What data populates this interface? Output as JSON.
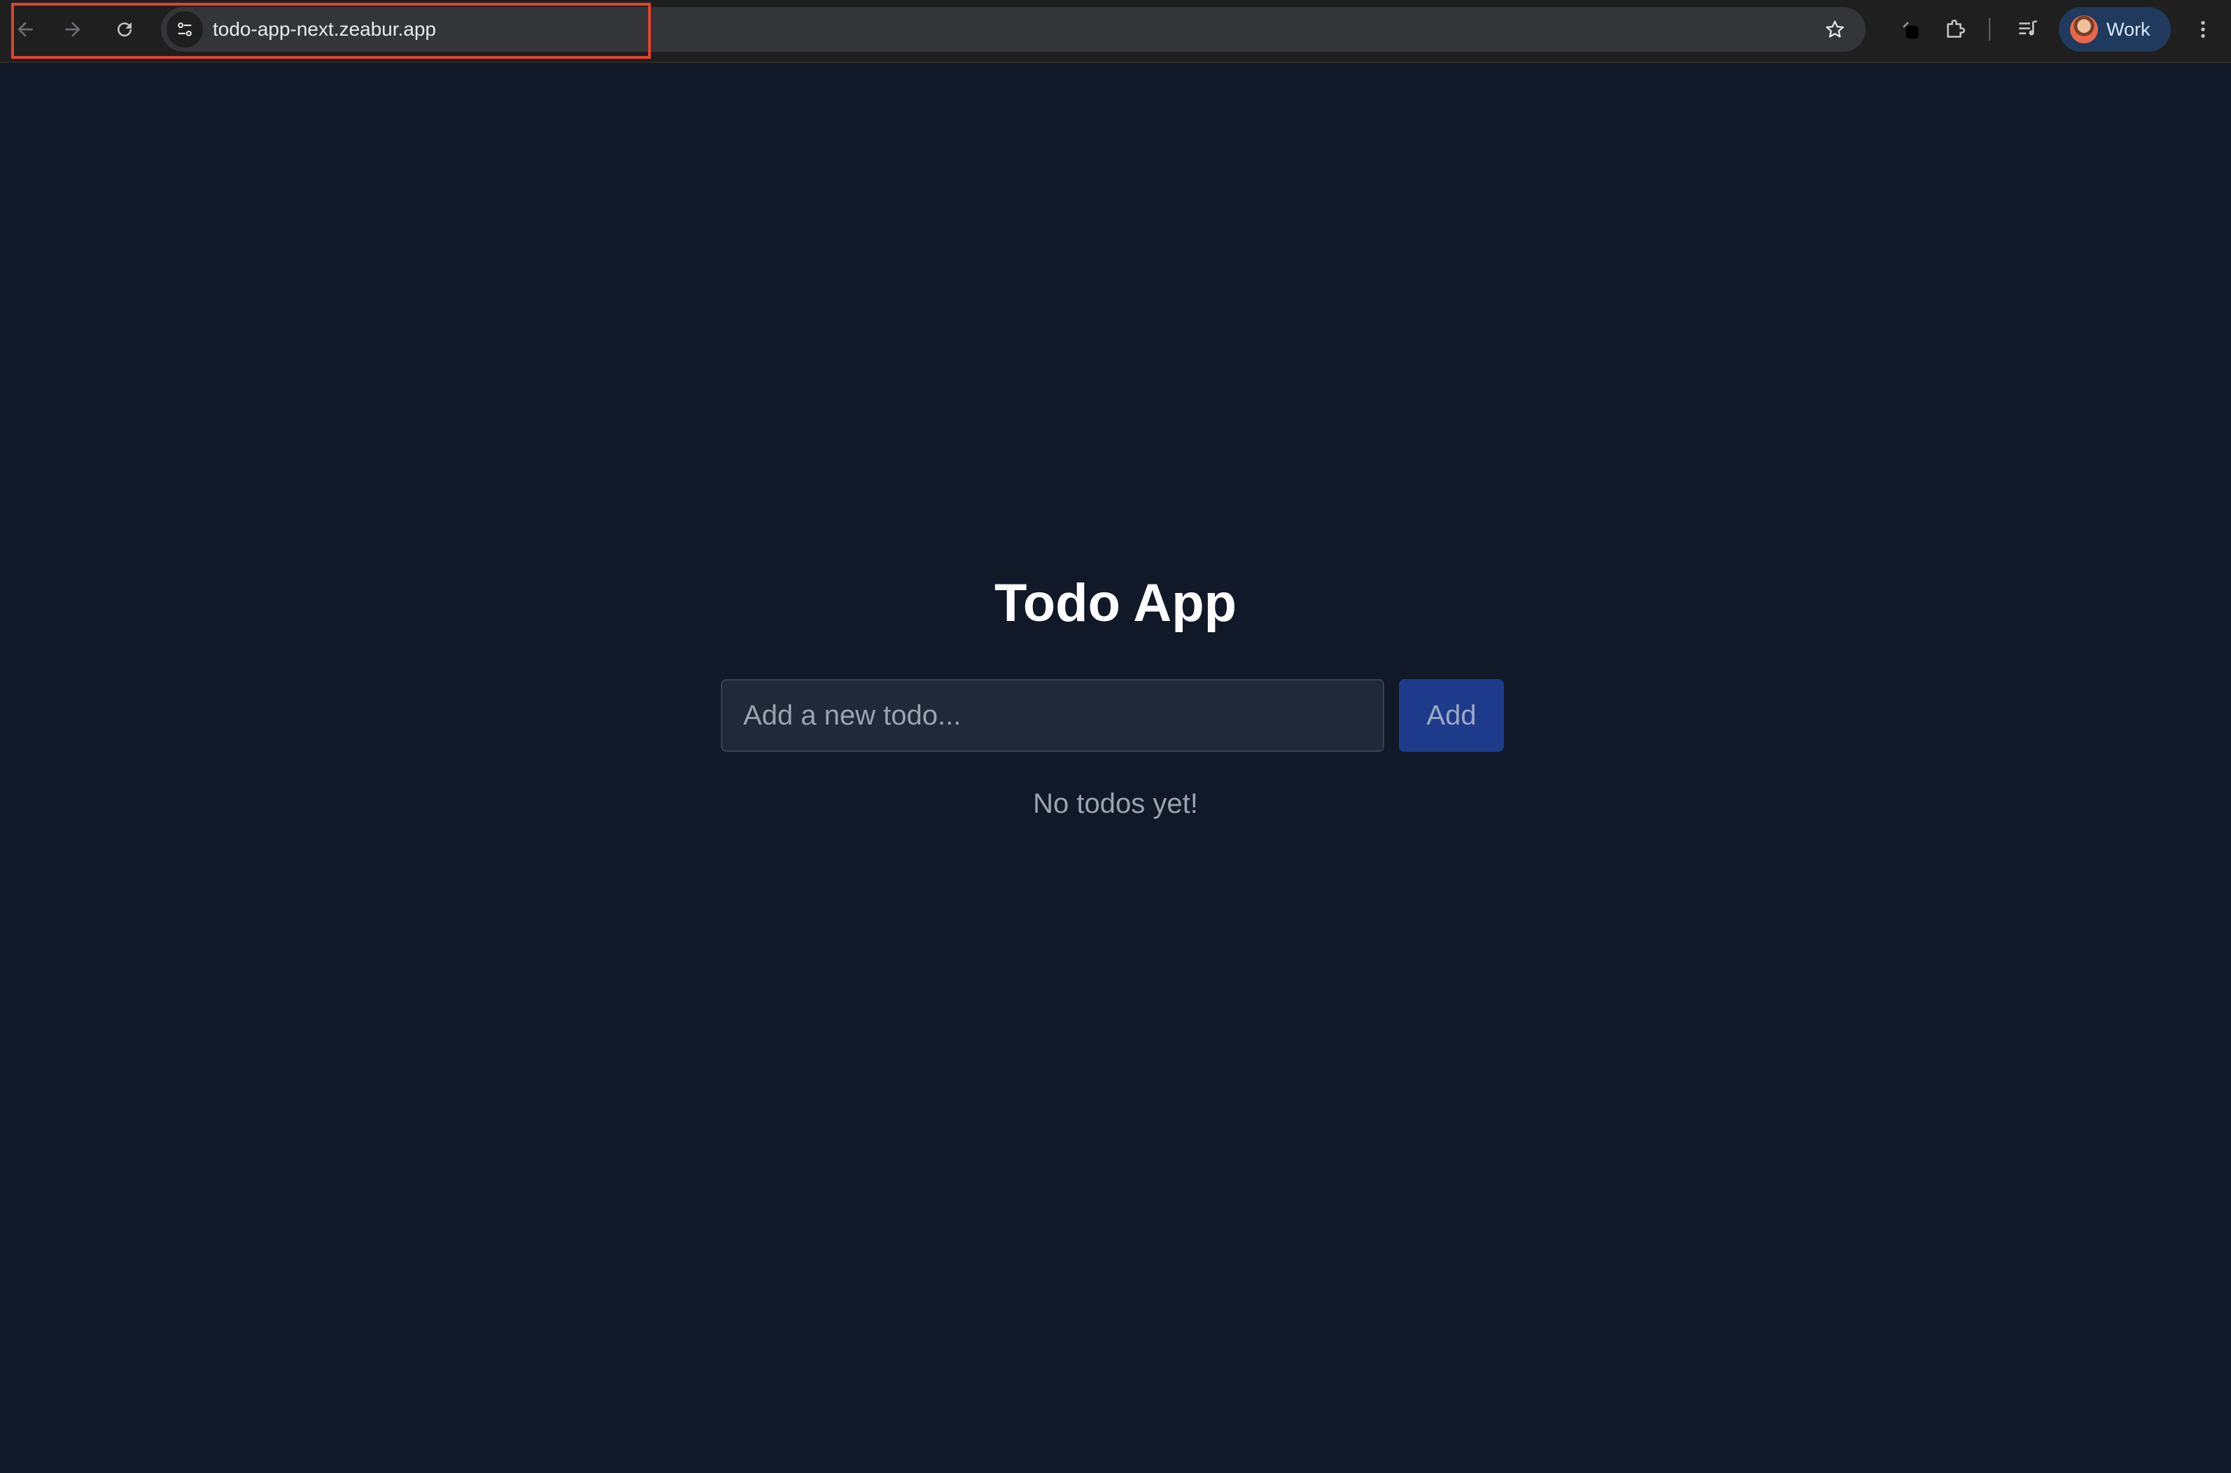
{
  "browser": {
    "url": "todo-app-next.zeabur.app",
    "profile_label": "Work",
    "icons": {
      "back": "arrow-left-icon",
      "forward": "arrow-right-icon",
      "reload": "reload-icon",
      "site_info": "tune-icon",
      "bookmark": "star-icon",
      "extension_pin": "extension-icon",
      "extensions": "puzzle-icon",
      "media": "media-control-icon",
      "menu": "more-vert-icon"
    },
    "highlight_color": "#e0432f"
  },
  "app": {
    "title": "Todo App",
    "input_placeholder": "Add a new todo...",
    "input_value": "",
    "add_button_label": "Add",
    "empty_message": "No todos yet!",
    "colors": {
      "background": "#111827",
      "input_background": "#1f2937",
      "button_background": "#1e3a8a"
    }
  }
}
